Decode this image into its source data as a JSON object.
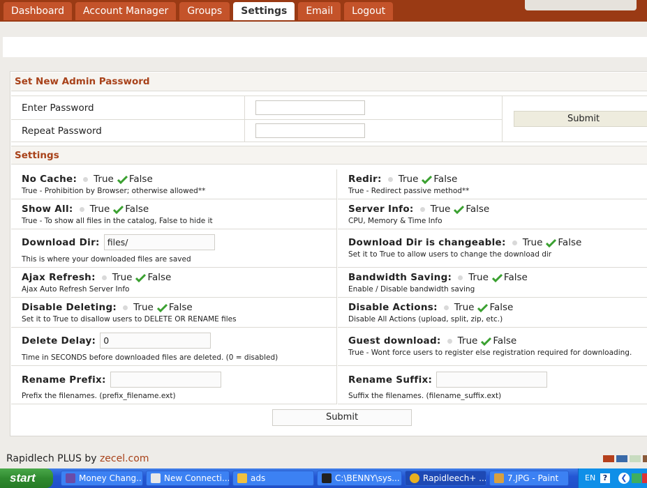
{
  "nav": {
    "tabs": [
      {
        "label": "Dashboard",
        "active": false
      },
      {
        "label": "Account Manager",
        "active": false
      },
      {
        "label": "Groups",
        "active": false
      },
      {
        "label": "Settings",
        "active": true
      },
      {
        "label": "Email",
        "active": false
      },
      {
        "label": "Logout",
        "active": false
      }
    ]
  },
  "password_section": {
    "title": "Set New Admin Password",
    "enter_label": "Enter Password",
    "repeat_label": "Repeat Password",
    "enter_value": "",
    "repeat_value": "",
    "submit_label": "Submit"
  },
  "settings": {
    "title": "Settings",
    "true_label": "True",
    "false_label": "False",
    "no_cache": {
      "name": "No Cache:",
      "value": "False",
      "desc": "True - Prohibition by Browser; otherwise allowed**"
    },
    "redir": {
      "name": "Redir:",
      "value": "False",
      "desc": "True - Redirect passive method**"
    },
    "show_all": {
      "name": "Show All:",
      "value": "False",
      "desc": "True - To show all files in the catalog, False to hide it"
    },
    "server_info": {
      "name": "Server Info:",
      "value": "False",
      "desc": "CPU, Memory & Time Info"
    },
    "download_dir": {
      "name": "Download Dir:",
      "value": "files/",
      "desc": "This is where your downloaded files are saved"
    },
    "download_dir_changeable": {
      "name": "Download Dir is changeable:",
      "value": "False",
      "desc": "Set it to True to allow users to change the download dir"
    },
    "ajax_refresh": {
      "name": "Ajax Refresh:",
      "value": "False",
      "desc": "Ajax Auto Refresh Server Info"
    },
    "bandwidth_saving": {
      "name": "Bandwidth Saving:",
      "value": "False",
      "desc": "Enable / Disable bandwidth saving"
    },
    "disable_deleting": {
      "name": "Disable Deleting:",
      "value": "False",
      "desc": "Set it to True to disallow users to DELETE OR RENAME files"
    },
    "disable_actions": {
      "name": "Disable Actions:",
      "value": "False",
      "desc": "Disable All Actions (upload, split, zip, etc.)"
    },
    "delete_delay": {
      "name": "Delete Delay:",
      "value": "0",
      "desc": "Time in SECONDS before downloaded files are deleted. (0 = disabled)"
    },
    "guest_download": {
      "name": "Guest download:",
      "value": "False",
      "desc": "True - Wont force users to register else registration required for downloading."
    },
    "rename_prefix": {
      "name": "Rename Prefix:",
      "value": "",
      "desc": "Prefix the filenames. (prefix_filename.ext)"
    },
    "rename_suffix": {
      "name": "Rename Suffix:",
      "value": "",
      "desc": "Suffix the filenames. (filename_suffix.ext)"
    },
    "submit_label": "Submit"
  },
  "footer": {
    "text": "Rapidlech PLUS by ",
    "brand": "zecel.com",
    "swatches": [
      "#b5401c",
      "#3a6aa8",
      "#c8dcc0",
      "#8a5a3a"
    ]
  },
  "taskbar": {
    "start_label": "start",
    "tasks": [
      {
        "label": "Money Chang...",
        "icon_color": "#6a4ca8"
      },
      {
        "label": "New Connecti...",
        "icon_color": "#e8e8e8"
      },
      {
        "label": "ads",
        "icon_color": "#f0c040"
      },
      {
        "label": "C:\\BENNY\\sys...",
        "icon_color": "#222222"
      },
      {
        "label": "Rapidleech+ ...",
        "icon_color": "#e8b020"
      },
      {
        "label": "7.JPG - Paint",
        "icon_color": "#d8a040"
      }
    ],
    "lang": "EN",
    "help": "?"
  }
}
